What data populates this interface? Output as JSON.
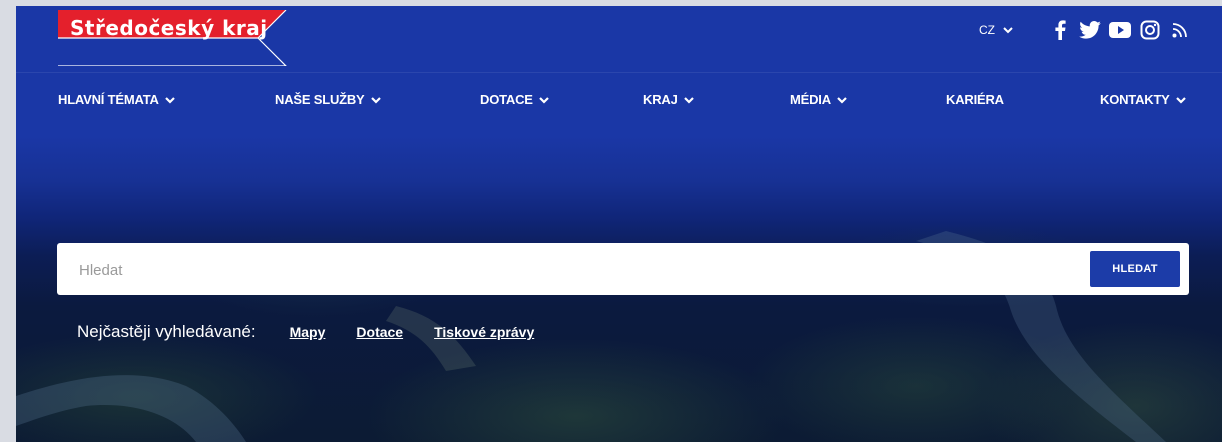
{
  "logo": {
    "text": "Středočeský kraj"
  },
  "language": {
    "current": "CZ"
  },
  "social": [
    {
      "icon": "facebook-icon"
    },
    {
      "icon": "twitter-icon"
    },
    {
      "icon": "youtube-icon"
    },
    {
      "icon": "instagram-icon"
    },
    {
      "icon": "rss-icon"
    }
  ],
  "nav": {
    "items": [
      {
        "label": "HLAVNÍ TÉMATA",
        "dropdown": true
      },
      {
        "label": "NAŠE SLUŽBY",
        "dropdown": true
      },
      {
        "label": "DOTACE",
        "dropdown": true
      },
      {
        "label": "KRAJ",
        "dropdown": true
      },
      {
        "label": "MÉDIA",
        "dropdown": true
      },
      {
        "label": "KARIÉRA",
        "dropdown": false
      },
      {
        "label": "KONTAKTY",
        "dropdown": true
      }
    ]
  },
  "search": {
    "placeholder": "Hledat",
    "value": "",
    "button_label": "HLEDAT"
  },
  "popular": {
    "label": "Nejčastěji vyhledávané:",
    "links": [
      "Mapy",
      "Dotace",
      "Tiskové zprávy"
    ]
  },
  "colors": {
    "brand_blue": "#1a37a6",
    "logo_red": "#e4202c",
    "button_blue": "#1c3ca8"
  }
}
